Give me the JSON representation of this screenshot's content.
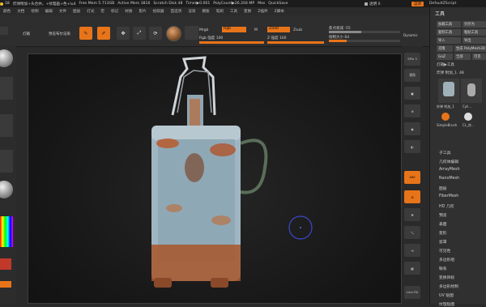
{
  "titlebar": {
    "items": [
      "18",
      "炸弹附加+头合并。+纹理画+色+lu4",
      "Free Mem 5.713GB",
      "Active Mem 3816",
      "Scratch Disk 48",
      "Timer▶0.001",
      "PolyCount▶26.204 MP",
      "Mes",
      "QuickSave"
    ],
    "transparency_label": "透明 0",
    "menu_btn": "菜单",
    "script_label": "DefaultZScript"
  },
  "menubar": [
    "颜色",
    "文档",
    "绘制",
    "编辑",
    "文件",
    "图层",
    "灯光",
    "宏",
    "标记",
    "材质",
    "影片",
    "拾取器",
    "首选项",
    "渲染",
    "模板",
    "笔刷",
    "工具",
    "变换",
    "Z插件",
    "Z脚本"
  ],
  "toolbar": {
    "btn_lightbox": "灯箱",
    "btn_preview": "预览布尔渲染",
    "mrgb": "Mrgb",
    "rgb": "Rgb",
    "m": "M",
    "rgb_intensity": "Rgb 强度 100",
    "zadd": "Zadd",
    "zsub": "Zsub",
    "z_intensity": "Z 强度 100",
    "focal_shift": "焦点衰减 -55",
    "draw_size": "绘制大小 64",
    "dynamic": "Dynamic",
    "icon_labels": [
      "编辑",
      "绘制",
      "移动",
      "缩放",
      "旋转"
    ]
  },
  "right_shelf": {
    "items": [
      "SPix 3",
      "视角",
      "",
      "",
      "",
      "",
      "",
      "",
      "",
      "",
      "",
      "",
      "",
      "",
      "",
      "",
      "Line Fill"
    ],
    "active_label": "ABE"
  },
  "palette": {
    "title": "工具",
    "load_tool": "加载工具",
    "save_as": "另存为",
    "copy_tool": "复制工具",
    "paste_tool": "粘贴工具",
    "import": "导入",
    "export": "导出",
    "clone": "克隆",
    "make_polymesh": "生成 PolyMesh3D",
    "goz": "GoZ",
    "all": "全部",
    "visible": "可见",
    "lightbox_tools": "灯箱▶工具",
    "current_tool": "炸弹 附加_1. 48",
    "thumb_labels": [
      "炸弹 附加_1",
      "Cyli...",
      "SimpleBrush",
      "CL_炸..."
    ],
    "sections": [
      "子工具",
      "几何体编辑",
      "ArrayMesh",
      "NanoMesh",
      "图层",
      "FiberMesh",
      "HD 几何",
      "预览",
      "表面",
      "变形",
      "遮罩",
      "可见性",
      "多边形组",
      "联系",
      "变换目标",
      "多边形绘制",
      "UV 贴图",
      "纹理贴图"
    ]
  },
  "accent_color": "#e8741a"
}
